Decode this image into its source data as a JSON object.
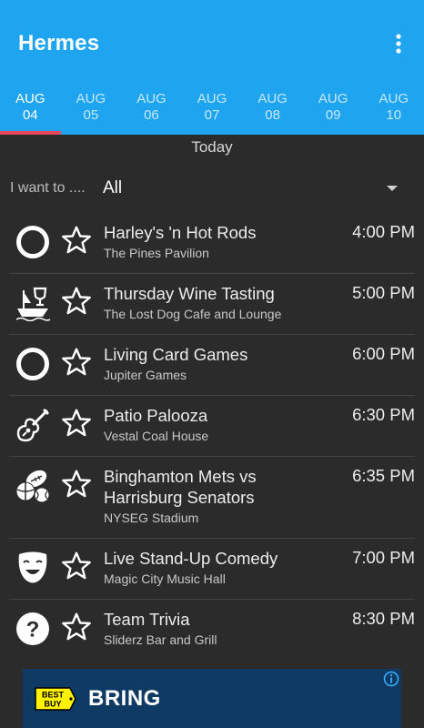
{
  "app": {
    "title": "Hermes"
  },
  "tabs": [
    {
      "month": "AUG",
      "day": "04",
      "active": true
    },
    {
      "month": "AUG",
      "day": "05",
      "active": false
    },
    {
      "month": "AUG",
      "day": "06",
      "active": false
    },
    {
      "month": "AUG",
      "day": "07",
      "active": false
    },
    {
      "month": "AUG",
      "day": "08",
      "active": false
    },
    {
      "month": "AUG",
      "day": "09",
      "active": false
    },
    {
      "month": "AUG",
      "day": "10",
      "active": false
    }
  ],
  "day_header": "Today",
  "filter": {
    "label": "I want to ....",
    "value": "All"
  },
  "events": [
    {
      "icon": "ring-icon",
      "title": "Harley's 'n Hot Rods",
      "venue": "The Pines Pavilion",
      "time": "4:00 PM"
    },
    {
      "icon": "wine-boat-icon",
      "title": "Thursday Wine Tasting",
      "venue": "The Lost Dog Cafe and Lounge",
      "time": "5:00 PM"
    },
    {
      "icon": "ring-icon",
      "title": "Living Card Games",
      "venue": "Jupiter Games",
      "time": "6:00 PM"
    },
    {
      "icon": "guitar-icon",
      "title": "Patio Palooza",
      "venue": "Vestal Coal House",
      "time": "6:30 PM"
    },
    {
      "icon": "sports-balls-icon",
      "title": "Binghamton Mets vs Harrisburg Senators",
      "venue": "NYSEG Stadium",
      "time": "6:35 PM"
    },
    {
      "icon": "theater-mask-icon",
      "title": "Live Stand-Up Comedy",
      "venue": "Magic City Music Hall",
      "time": "7:00 PM"
    },
    {
      "icon": "question-icon",
      "title": "Team Trivia",
      "venue": "Sliderz Bar and Grill",
      "time": "8:30 PM"
    }
  ],
  "ad": {
    "logo_text": "BEST BUY",
    "text": "BRING"
  },
  "colors": {
    "appbar": "#1fa4f0",
    "indicator": "#e8485d",
    "background": "#2b2b2b",
    "ad_background": "#0e3a64",
    "bestbuy_yellow": "#fff200"
  }
}
